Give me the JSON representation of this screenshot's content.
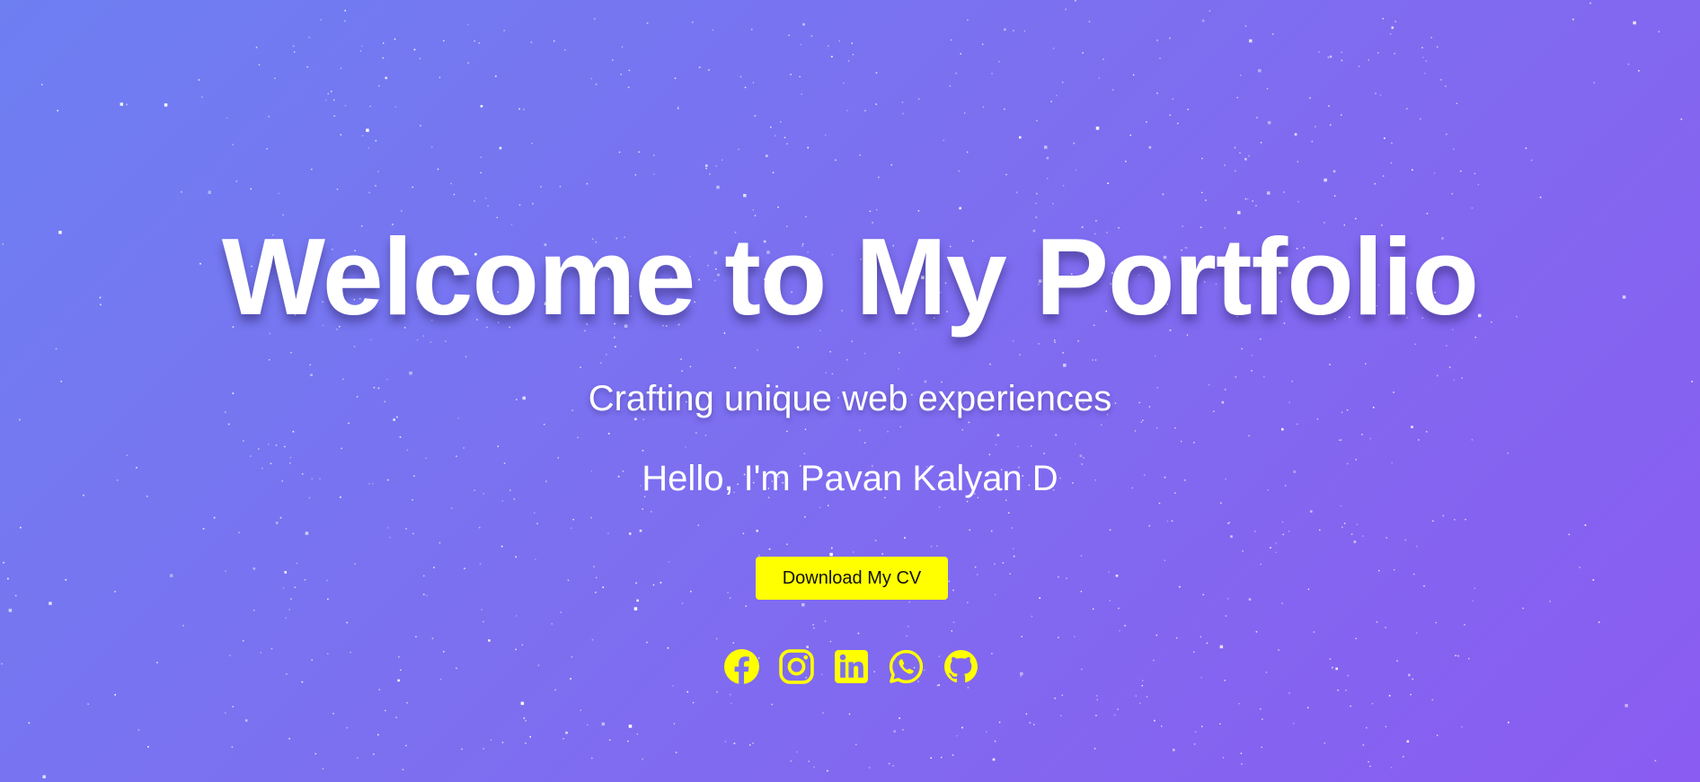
{
  "hero": {
    "title": "Welcome to My Portfolio",
    "subtitle": "Crafting unique web experiences",
    "greeting": "Hello, I'm Pavan Kalyan D",
    "cv_button_label": "Download My CV"
  },
  "socials": [
    {
      "name": "facebook-icon"
    },
    {
      "name": "instagram-icon"
    },
    {
      "name": "linkedin-icon"
    },
    {
      "name": "whatsapp-icon"
    },
    {
      "name": "github-icon"
    }
  ],
  "colors": {
    "background_start": "#6e7ff2",
    "background_end": "#8a5cf1",
    "accent": "#ffff00",
    "text": "#ffffff"
  }
}
